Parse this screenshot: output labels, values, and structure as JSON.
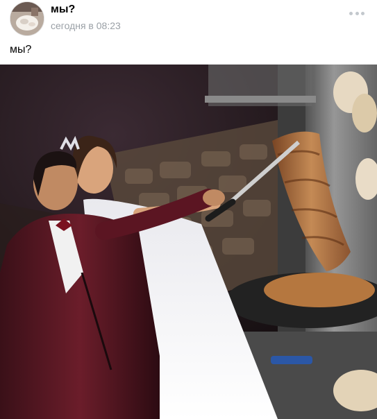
{
  "post": {
    "author": "мы?",
    "timestamp": "сегодня в 08:23",
    "text": "мы?",
    "menu_icon": "more-horizontal-icon",
    "avatar_icon": "avatar-photo",
    "photo_icon": "wedding-shawarma-photo"
  },
  "colors": {
    "time_gray": "#9aa0a6",
    "dots_gray": "#c3c8cd",
    "text_black": "#000000"
  }
}
